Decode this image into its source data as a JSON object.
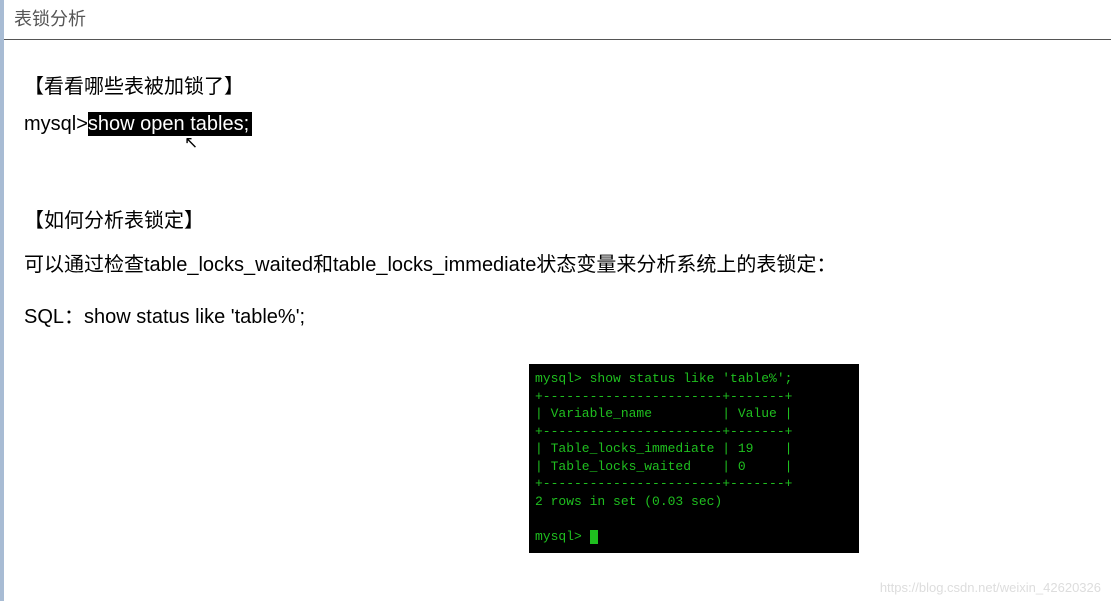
{
  "title": "表锁分析",
  "section1_heading": "【看看哪些表被加锁了】",
  "cmd_prompt": "mysql>",
  "cmd_selected": "show open tables;",
  "section2_heading": "【如何分析表锁定】",
  "analysis_para": "可以通过检查table_locks_waited和table_locks_immediate状态变量来分析系统上的表锁定：",
  "sql_line": "SQL：show status like 'table%';",
  "terminal": {
    "line1": "mysql> show status like 'table%';",
    "sep_top": "+-----------------------+-------+",
    "header": "| Variable_name         | Value |",
    "sep_mid": "+-----------------------+-------+",
    "row1": "| Table_locks_immediate | 19    |",
    "row2": "| Table_locks_waited    | 0     |",
    "sep_bot": "+-----------------------+-------+",
    "summary": "2 rows in set (0.03 sec)",
    "prompt2": "mysql> "
  },
  "chart_data": {
    "type": "table",
    "title": "show status like 'table%'",
    "columns": [
      "Variable_name",
      "Value"
    ],
    "rows": [
      {
        "Variable_name": "Table_locks_immediate",
        "Value": 19
      },
      {
        "Variable_name": "Table_locks_waited",
        "Value": 0
      }
    ],
    "summary": "2 rows in set (0.03 sec)"
  },
  "watermark": "https://blog.csdn.net/weixin_42620326"
}
